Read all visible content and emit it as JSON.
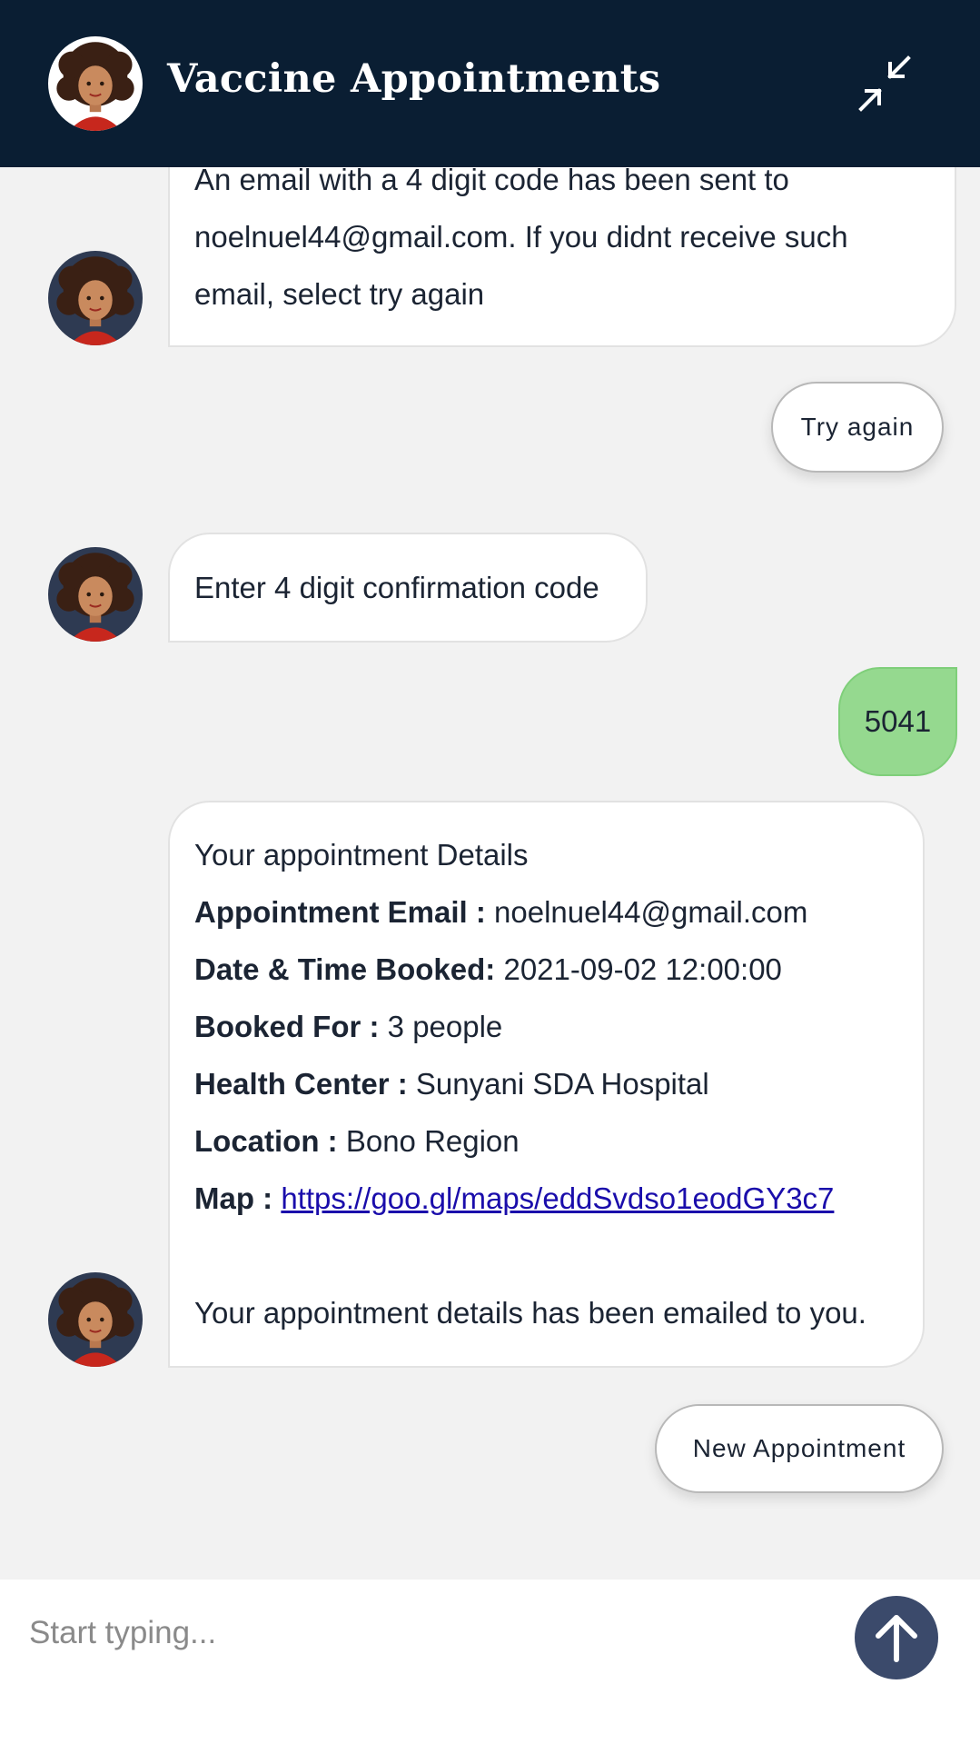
{
  "header": {
    "title": "Vaccine Appointments",
    "avatar_icon": "agent-avatar-icon",
    "minimize_icon": "minimize-arrows-icon",
    "background": "#0a1e33"
  },
  "messages": {
    "email_sent": {
      "line1": "An email with a 4 digit code has been sent to",
      "line2": "noelnuel44@gmail.com. If you didnt receive such",
      "line3": "email, select try again"
    },
    "try_again_label": "Try again",
    "enter_code": "Enter 4 digit confirmation code",
    "user_code": "5041",
    "details": {
      "heading": "Your appointment Details",
      "email_label": "Appointment Email :",
      "email_value": "noelnuel44@gmail.com",
      "datetime_label": "Date & Time Booked:",
      "datetime_value": "2021-09-02 12:00:00",
      "booked_for_label": "Booked For :",
      "booked_for_value": "3 people",
      "health_center_label": "Health Center :",
      "health_center_value": "Sunyani SDA Hospital",
      "location_label": "Location :",
      "location_value": "Bono Region",
      "map_label": "Map :",
      "map_link": "https://goo.gl/maps/eddSvdso1eodGY3c7",
      "footer": "Your appointment details has been emailed to you."
    },
    "new_appointment_label": "New Appointment"
  },
  "composer": {
    "placeholder": "Start typing...",
    "send_icon": "send-arrow-up-icon"
  },
  "colors": {
    "user_bubble": "#95d98f",
    "send_button": "#3b4a6b",
    "chat_background": "#f2f2f2"
  }
}
